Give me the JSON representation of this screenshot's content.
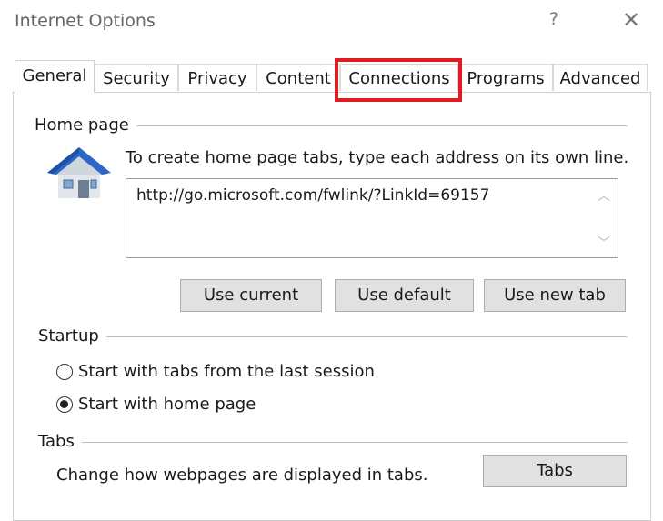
{
  "window": {
    "title": "Internet Options",
    "help_label": "?",
    "close_label": "✕"
  },
  "tabs": [
    {
      "label": "General",
      "active": true
    },
    {
      "label": "Security"
    },
    {
      "label": "Privacy"
    },
    {
      "label": "Content"
    },
    {
      "label": "Connections",
      "highlighted": true
    },
    {
      "label": "Programs"
    },
    {
      "label": "Advanced"
    }
  ],
  "highlight_color": "#e21b22",
  "home_page": {
    "group_label": "Home page",
    "instructions": "To create home page tabs, type each address on its own line.",
    "addresses": "http://go.microsoft.com/fwlink/?LinkId=69157",
    "buttons": {
      "use_current": "Use current",
      "use_default": "Use default",
      "use_new_tab": "Use new tab"
    }
  },
  "startup": {
    "group_label": "Startup",
    "options": [
      {
        "label": "Start with tabs from the last session",
        "checked": false
      },
      {
        "label": "Start with home page",
        "checked": true
      }
    ]
  },
  "tabs_section": {
    "group_label": "Tabs",
    "description": "Change how webpages are displayed in tabs.",
    "button": "Tabs"
  },
  "icons": {
    "home": "house-icon",
    "scroll_up": "chevron-up-icon",
    "scroll_down": "chevron-down-icon"
  }
}
